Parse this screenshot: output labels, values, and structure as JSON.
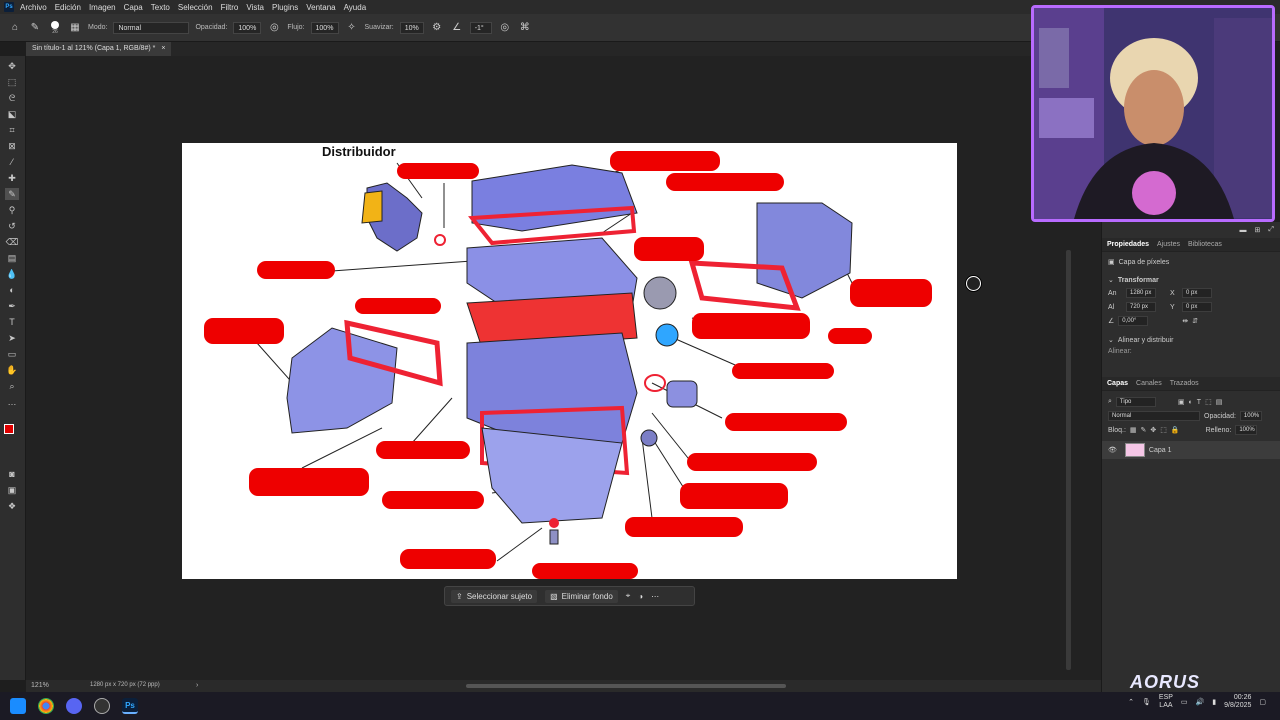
{
  "menu": {
    "items": [
      "Archivo",
      "Edición",
      "Imagen",
      "Capa",
      "Texto",
      "Selección",
      "Filtro",
      "Vista",
      "Plugins",
      "Ventana",
      "Ayuda"
    ]
  },
  "options": {
    "brush_size": "26",
    "mode_label": "Modo:",
    "mode_value": "Normal",
    "opacity_label": "Opacidad:",
    "opacity_value": "100%",
    "flow_label": "Flujo:",
    "flow_value": "100%",
    "smoothing_label": "Suavizar:",
    "smoothing_value": "10%",
    "angle_value": "-1°"
  },
  "document": {
    "tab_title": "Sin título-1 al 121% (Capa 1, RGB/8#) *",
    "diagram_title": "Distribuidor"
  },
  "status": {
    "zoom": "121%",
    "doc_size": "1280 px x 720 px (72 ppp)"
  },
  "context_bar": {
    "select_subject": "Seleccionar sujeto",
    "remove_bg": "Eliminar fondo"
  },
  "properties": {
    "tabs": [
      "Propiedades",
      "Ajustes",
      "Bibliotecas"
    ],
    "layer_type": "Capa de píxeles",
    "transform_label": "Transformar",
    "w_label": "An",
    "w_value": "1280 px",
    "h_label": "Al",
    "h_value": "720 px",
    "x_label": "X",
    "x_value": "0 px",
    "y_label": "Y",
    "y_value": "0 px",
    "angle": "0,00°",
    "align_section": "Alinear y distribuir",
    "align_label": "Alinear:"
  },
  "layers": {
    "tabs": [
      "Capas",
      "Canales",
      "Trazados"
    ],
    "filter_label": "Tipo",
    "blend_mode": "Normal",
    "opacity_label": "Opacidad:",
    "opacity_value": "100%",
    "lock_label": "Bloq.:",
    "fill_label": "Relleno:",
    "fill_value": "100%",
    "layer_name": "Capa 1"
  },
  "taskbar": {
    "lang_top": "ESP",
    "lang_bottom": "LAA",
    "time": "00:26",
    "date": "9/8/2025",
    "brand": "AORUS",
    "ps_label": "Ps"
  },
  "colors": {
    "foreground": "#e00000",
    "background": "#ffffff",
    "redact": "#ee0000",
    "webcam_border": "#b86bff"
  }
}
